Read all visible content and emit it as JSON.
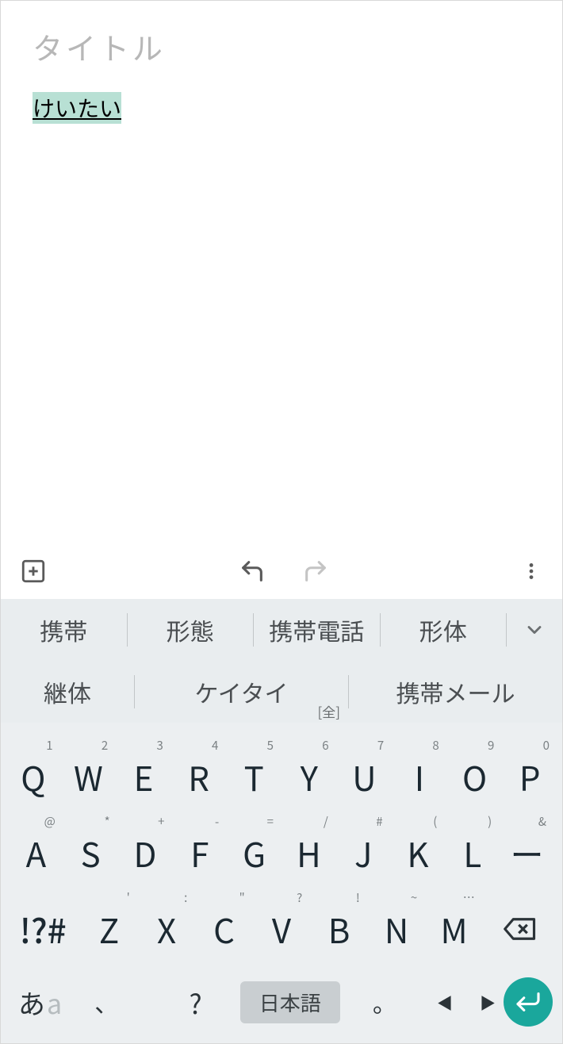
{
  "note": {
    "title_placeholder": "タイトル",
    "composing_text": "けいたい"
  },
  "toolbar": {
    "add": "add-icon",
    "undo": "undo-icon",
    "redo": "redo-icon",
    "more": "more-icon"
  },
  "suggestions": {
    "row1": [
      "携帯",
      "形態",
      "携帯電話",
      "形体"
    ],
    "row2": [
      {
        "text": "継体"
      },
      {
        "text": "ケイタイ",
        "sub": "[全]"
      },
      {
        "text": "携帯メール"
      }
    ],
    "expand_icon": "chevron-down-icon"
  },
  "keyboard": {
    "row1": [
      {
        "main": "Q",
        "hint": "1"
      },
      {
        "main": "W",
        "hint": "2"
      },
      {
        "main": "E",
        "hint": "3"
      },
      {
        "main": "R",
        "hint": "4"
      },
      {
        "main": "T",
        "hint": "5"
      },
      {
        "main": "Y",
        "hint": "6"
      },
      {
        "main": "U",
        "hint": "7"
      },
      {
        "main": "I",
        "hint": "8"
      },
      {
        "main": "O",
        "hint": "9"
      },
      {
        "main": "P",
        "hint": "0"
      }
    ],
    "row2": [
      {
        "main": "A",
        "hint": "@"
      },
      {
        "main": "S",
        "hint": "*"
      },
      {
        "main": "D",
        "hint": "+"
      },
      {
        "main": "F",
        "hint": "-"
      },
      {
        "main": "G",
        "hint": "="
      },
      {
        "main": "H",
        "hint": "/"
      },
      {
        "main": "J",
        "hint": "#"
      },
      {
        "main": "K",
        "hint": "("
      },
      {
        "main": "L",
        "hint": ")"
      },
      {
        "main": "ー",
        "hint": "&"
      }
    ],
    "row3": [
      {
        "main": "Z",
        "hint": "'"
      },
      {
        "main": "X",
        "hint": ":"
      },
      {
        "main": "C",
        "hint": "\""
      },
      {
        "main": "V",
        "hint": "?"
      },
      {
        "main": "B",
        "hint": "!"
      },
      {
        "main": "N",
        "hint": "~"
      },
      {
        "main": "M",
        "hint": "…"
      }
    ],
    "sym_key": "!?#",
    "backspace": "backspace-icon",
    "bottom": {
      "mode_jp": "あ",
      "mode_en": "a",
      "comma": "、",
      "question": "?",
      "language": "日本語",
      "period": "。",
      "arrow_left": "◀",
      "arrow_right": "▶",
      "enter": "enter-icon"
    }
  },
  "colors": {
    "accent": "#1aa79c",
    "highlight": "#b8e0d4",
    "kbd_bg": "#eceff1",
    "sug_bg": "#e9edef"
  }
}
